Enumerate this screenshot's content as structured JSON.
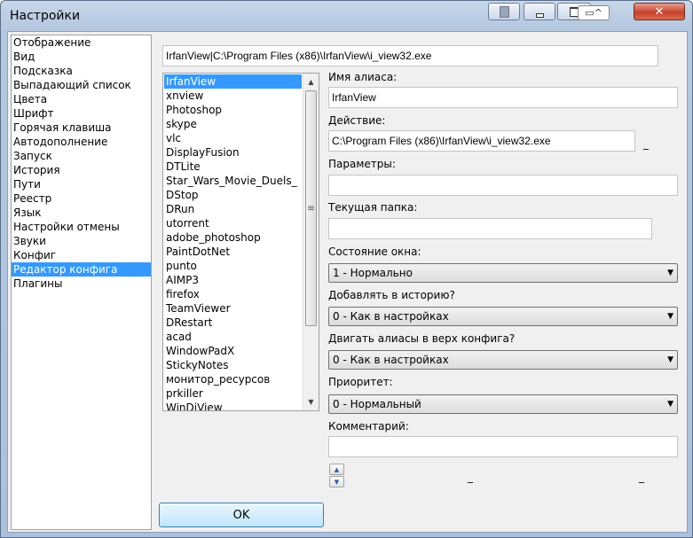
{
  "window": {
    "title": "Настройки",
    "buttons": {
      "pin": "pin-icon",
      "minimize": "minimize-icon",
      "restore": "restore-icon",
      "close": "close-icon"
    }
  },
  "sidebar": {
    "items": [
      {
        "label": "Отображение"
      },
      {
        "label": "Вид"
      },
      {
        "label": "Подсказка"
      },
      {
        "label": "Выпадающий список"
      },
      {
        "label": "Цвета"
      },
      {
        "label": "Шрифт"
      },
      {
        "label": "Горячая клавиша"
      },
      {
        "label": "Автодополнение"
      },
      {
        "label": "Запуск"
      },
      {
        "label": "История"
      },
      {
        "label": "Пути"
      },
      {
        "label": "Реестр"
      },
      {
        "label": "Язык"
      },
      {
        "label": "Настройки отмены"
      },
      {
        "label": "Звуки"
      },
      {
        "label": "Конфиг"
      },
      {
        "label": "Редактор конфига",
        "selected": true
      },
      {
        "label": "Плагины"
      }
    ]
  },
  "editor": {
    "config_line": "IrfanView|C:\\Program Files (x86)\\IrfanView\\i_view32.exe",
    "aliases": [
      "IrfanView",
      "xnview",
      "Photoshop",
      "skype",
      "vlc",
      "DisplayFusion",
      "DTLite",
      "Star_Wars_Movie_Duels_",
      "DStop",
      "DRun",
      "utorrent",
      "adobe_photoshop",
      "PaintDotNet",
      "punto",
      "AIMP3",
      "firefox",
      "TeamViewer",
      "DRestart",
      "acad",
      "WindowPadX",
      "StickyNotes",
      "монитор_ресурсов",
      "prkiller",
      "WinDiView"
    ],
    "selected_alias": 0,
    "alias_name_label": "Имя алиаса:",
    "alias_name_value": "IrfanView",
    "action_label": "Действие:",
    "action_value": "C:\\Program Files (x86)\\IrfanView\\i_view32.exe",
    "action_browse": "_",
    "params_label": "Параметры:",
    "params_value": "",
    "workdir_label": "Текущая папка:",
    "workdir_value": "",
    "window_state_label": "Состояние окна:",
    "window_state_value": "1 - Нормально",
    "add_history_label": "Добавлять в историю?",
    "add_history_value": "0 - Как в настройках",
    "move_top_label": "Двигать алиасы в верх конфига?",
    "move_top_value": "0 - Как в настройках",
    "priority_label": "Приоритет:",
    "priority_value": "0 - Нормальный",
    "comment_label": "Комментарий:",
    "comment_value": "",
    "bottom_dash_1": "_",
    "bottom_dash_2": "_"
  },
  "ok_button": "OK"
}
